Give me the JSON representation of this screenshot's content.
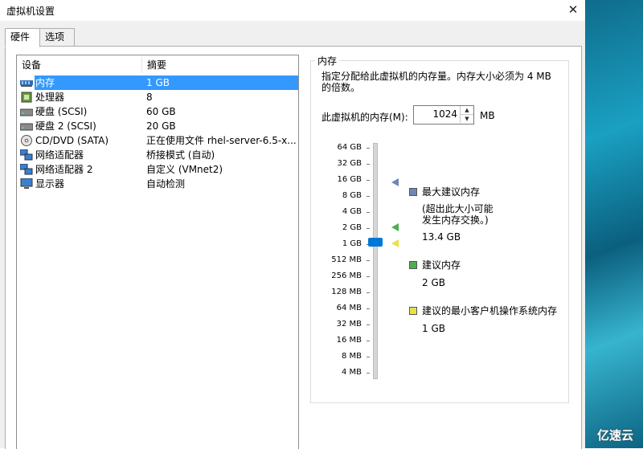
{
  "window": {
    "title": "虚拟机设置",
    "close": "✕"
  },
  "tabs": [
    {
      "label": "硬件"
    },
    {
      "label": "选项"
    }
  ],
  "device_list": {
    "headers": [
      "设备",
      "摘要"
    ],
    "rows": [
      {
        "icon": "memory-icon",
        "device": "内存",
        "summary": "1 GB"
      },
      {
        "icon": "processor-icon",
        "device": "处理器",
        "summary": "8"
      },
      {
        "icon": "disk-icon",
        "device": "硬盘 (SCSI)",
        "summary": "60 GB"
      },
      {
        "icon": "disk-icon",
        "device": "硬盘 2 (SCSI)",
        "summary": "20 GB"
      },
      {
        "icon": "cd-dvd-icon",
        "device": "CD/DVD (SATA)",
        "summary": "正在使用文件 rhel-server-6.5-x..."
      },
      {
        "icon": "network-icon",
        "device": "网络适配器",
        "summary": "桥接模式 (自动)"
      },
      {
        "icon": "network-icon",
        "device": "网络适配器 2",
        "summary": "自定义 (VMnet2)"
      },
      {
        "icon": "display-icon",
        "device": "显示器",
        "summary": "自动检测"
      }
    ]
  },
  "memory_panel": {
    "group_label": "内存",
    "description": "指定分配给此虚拟机的内存量。内存大小必须为 4 MB 的倍数。",
    "field_label": "此虚拟机的内存(M):",
    "value": "1024",
    "unit": "MB",
    "scale_labels": [
      "64 GB",
      "32 GB",
      "16 GB",
      "8 GB",
      "4 GB",
      "2 GB",
      "1 GB",
      "512 MB",
      "256 MB",
      "128 MB",
      "64 MB",
      "32 MB",
      "16 MB",
      "8 MB",
      "4 MB"
    ],
    "legend": {
      "max": {
        "title": "最大建议内存",
        "note1": "(超出此大小可能",
        "note2": "发生内存交换。)",
        "value": "13.4 GB",
        "color": "#6f86b8"
      },
      "recommended": {
        "title": "建议内存",
        "value": "2 GB",
        "color": "#4caf50"
      },
      "min_guest": {
        "title": "建议的最小客户机操作系统内存",
        "value": "1 GB",
        "color": "#e8e24a"
      }
    }
  },
  "watermark": "亿速云"
}
